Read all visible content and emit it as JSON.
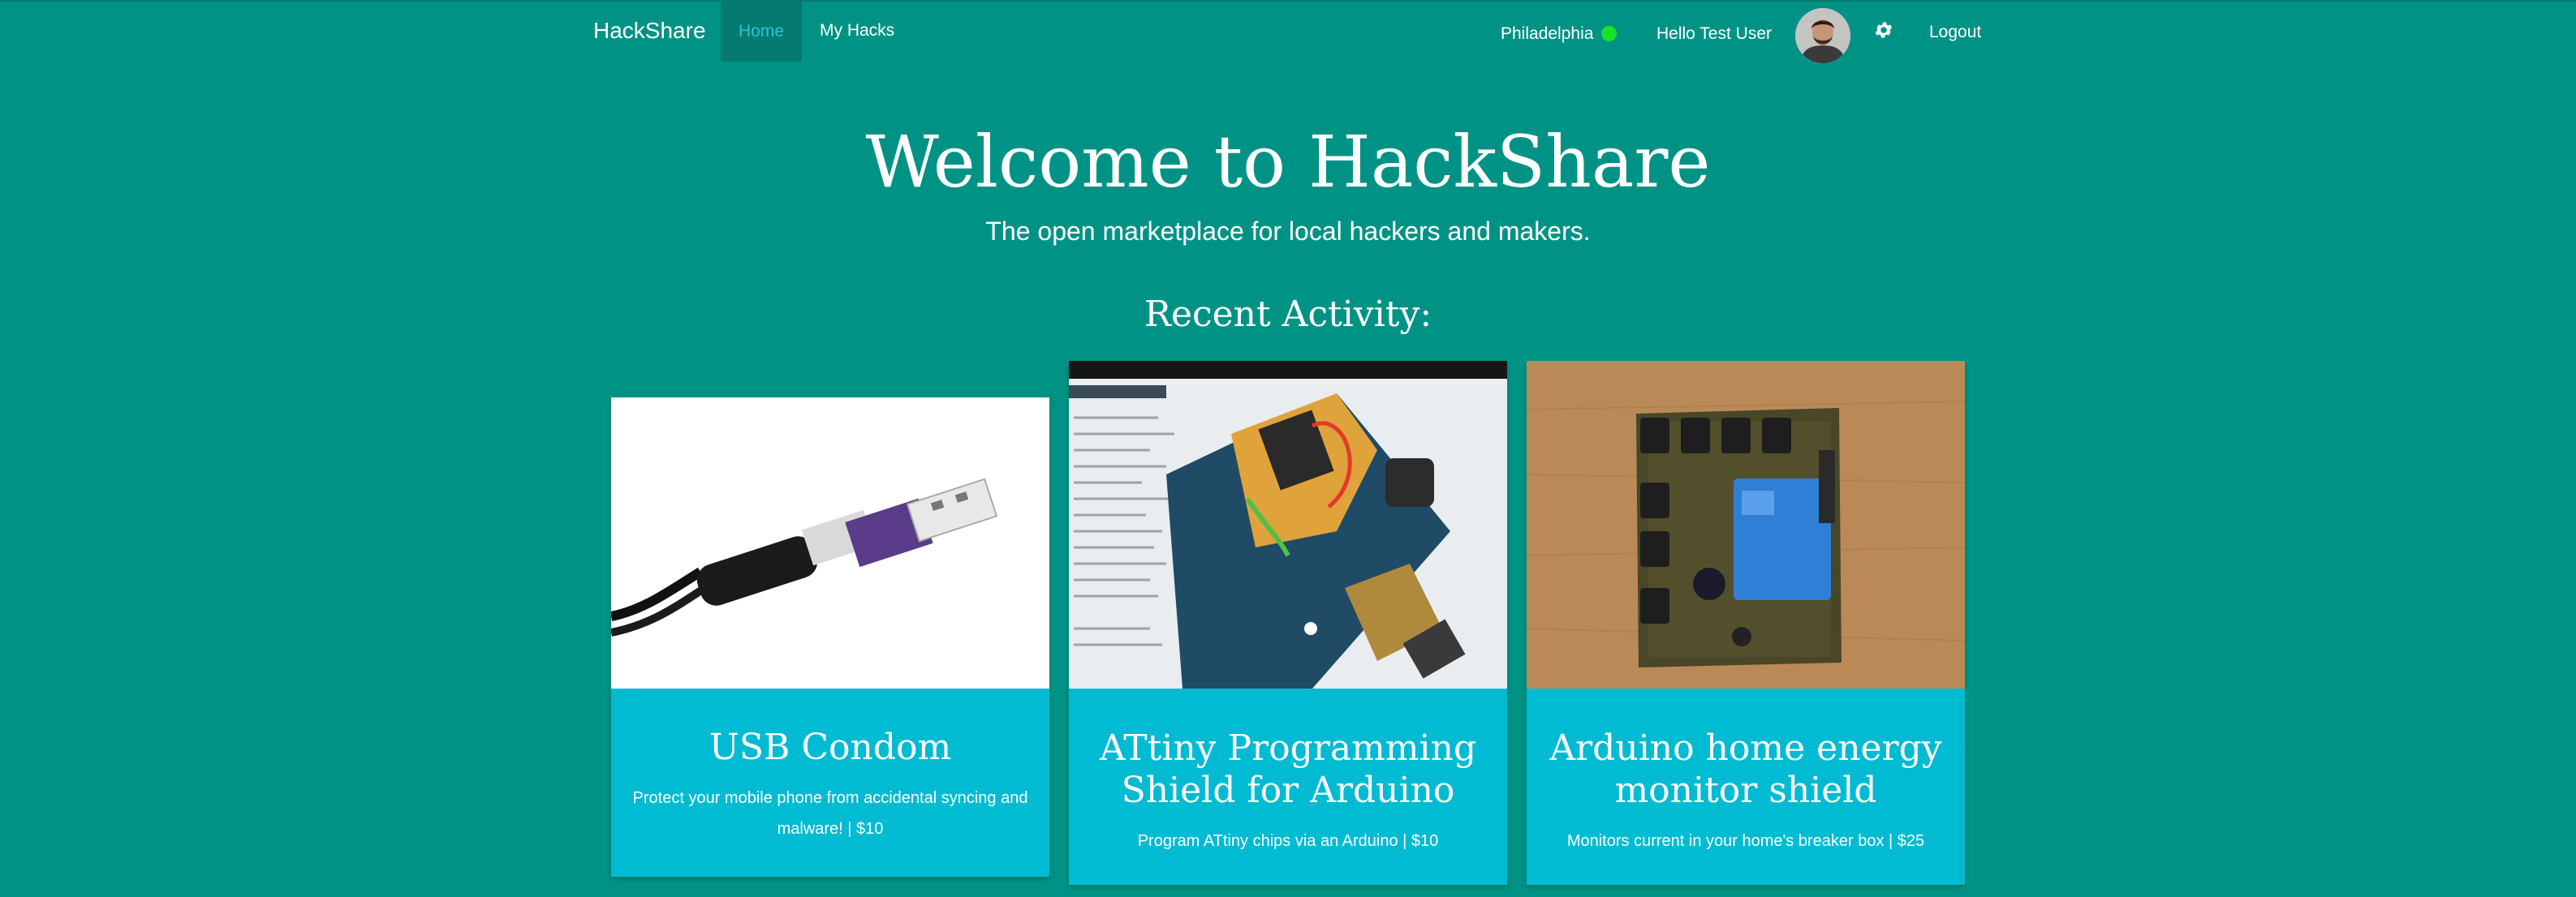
{
  "nav": {
    "brand": "HackShare",
    "home": "Home",
    "my_hacks": "My Hacks",
    "location": "Philadelphia",
    "greeting": "Hello Test User",
    "logout": "Logout"
  },
  "hero": {
    "title": "Welcome to HackShare",
    "subtitle": "The open marketplace for local hackers and makers."
  },
  "recent": {
    "heading": "Recent Activity:",
    "cards": [
      {
        "title": "USB Condom",
        "description": "Protect your mobile phone from accidental syncing and malware! | $10"
      },
      {
        "title": "ATtiny Programming Shield for Arduino",
        "description": "Program ATtiny chips via an Arduino | $10"
      },
      {
        "title": "Arduino home energy monitor shield",
        "description": "Monitors current in your home's breaker box | $25"
      }
    ]
  },
  "colors": {
    "background": "#009385",
    "active_nav": "#047a70",
    "card": "#01bbd3",
    "online_dot": "#16e32a"
  }
}
